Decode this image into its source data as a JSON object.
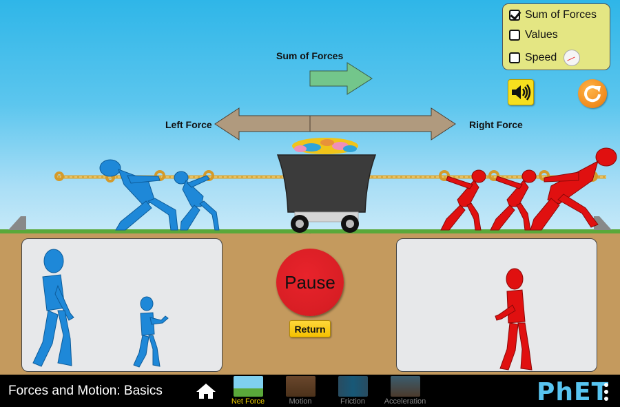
{
  "options_panel": {
    "items": [
      {
        "label": "Sum of Forces",
        "checked": true
      },
      {
        "label": "Values",
        "checked": false
      },
      {
        "label": "Speed",
        "checked": false
      }
    ],
    "speedometer_label": "Speed"
  },
  "controls": {
    "sound_icon": "speaker-on-icon",
    "reset_icon": "reset-all-icon"
  },
  "force_labels": {
    "sum": "Sum of Forces",
    "left": "Left Force",
    "right": "Right Force"
  },
  "playback": {
    "pause_label": "Pause",
    "return_label": "Return"
  },
  "teams": {
    "left": {
      "color": "#1e88d8",
      "pullers_on_rope": 2,
      "pullers_waiting": 2
    },
    "right": {
      "color": "#e01010",
      "pullers_on_rope": 3,
      "pullers_waiting": 1
    }
  },
  "footer": {
    "title": "Forces and Motion: Basics",
    "home_icon": "home-icon",
    "tabs": [
      {
        "label": "Net Force",
        "active": true
      },
      {
        "label": "Motion",
        "active": false
      },
      {
        "label": "Friction",
        "active": false
      },
      {
        "label": "Acceleration",
        "active": false
      }
    ],
    "brand": "PhET"
  },
  "colors": {
    "sum_arrow": "#73c68b",
    "force_arrow": "#b09a7e",
    "active_tab": "#f2d300",
    "panel_bg": "#e4e683"
  }
}
